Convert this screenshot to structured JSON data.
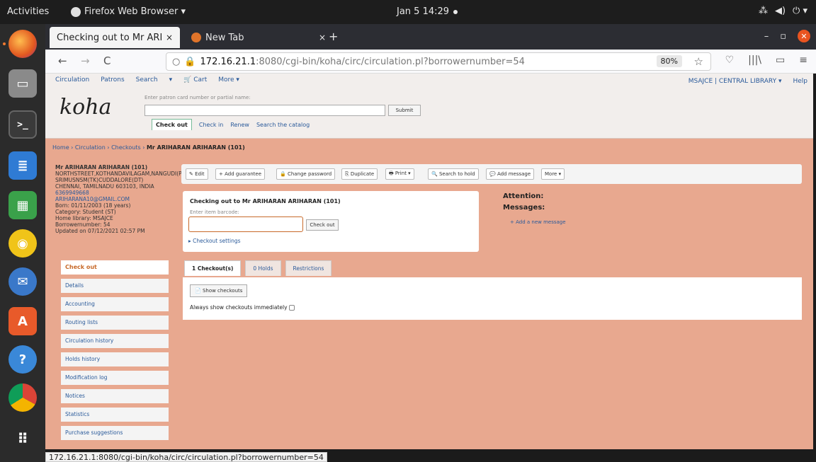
{
  "os_bar": {
    "activities": "Activities",
    "app_name": "Firefox Web Browser ▾",
    "clock": "Jan 5 14:29",
    "tray": [
      "⁂",
      "◀)",
      "⏻ ▾"
    ]
  },
  "browser": {
    "tabs": [
      {
        "title": "Checking out to Mr ARIHAR/",
        "close": "×"
      },
      {
        "title": "New Tab",
        "close": "×"
      }
    ],
    "new_tab": "+",
    "window_controls": [
      "–",
      "▫",
      "✕"
    ],
    "nav": {
      "back": "←",
      "forward": "→",
      "reload": "C"
    },
    "url_host": "172.16.21.1",
    "url_path": ":8080/cgi-bin/koha/circ/circulation.pl?borrowernumber=54",
    "zoom": "80%",
    "nav_right_icons": [
      "♡",
      "|||\\",
      "▭",
      "≡"
    ],
    "status_url": "172.16.21.1:8080/cgi-bin/koha/circ/circulation.pl?borrowernumber=54"
  },
  "koha": {
    "menu": [
      "Circulation",
      "Patrons",
      "Search",
      "▾",
      "🛒 Cart",
      "More ▾"
    ],
    "right_menu": [
      "MSAJCE | CENTRAL LIBRARY ▾",
      "Help"
    ],
    "logo": "koha",
    "search_prompt": "Enter patron card number or partial name:",
    "submit": "Submit",
    "search_tabs": [
      "Check out",
      "Check in",
      "Renew",
      "Search the catalog"
    ],
    "breadcrumb": {
      "home": "Home",
      "circulation": "Circulation",
      "checkouts": "Checkouts",
      "current": "Mr ARIHARAN ARIHARAN (101)"
    },
    "patron": {
      "name": "Mr ARIHARAN ARIHARAN (101)",
      "address1": "NORTHSTREET,KOTHANDAVILAGAM,NANGUDI(PO),",
      "address2": "SRIMUSNSM(TK)CUDDALORE(DT)",
      "address3": "CHENNAI, TAMILNADU 603103, INDIA",
      "phone": "6369949668",
      "email": "ARIHARANA10@GMAIL.COM",
      "born": "Born: 01/11/2003 (18 years)",
      "category": "Category: Student (ST)",
      "library": "Home library: MSAJCE",
      "borrowernumber": "Borrowernumber: 54",
      "updated": "Updated on 07/12/2021 02:57 PM"
    },
    "toolbar": [
      "✎ Edit",
      "+ Add guarantee",
      "🔒 Change password",
      "⎘ Duplicate",
      "🖶 Print ▾",
      "🔍 Search to hold",
      "💬 Add message",
      "More ▾"
    ],
    "checkout": {
      "title": "Checking out to Mr ARIHARAN ARIHARAN (101)",
      "barcode_label": "Enter item barcode:",
      "button": "Check out",
      "settings": "▸ Checkout settings"
    },
    "attention": "Attention:",
    "messages": "Messages:",
    "add_message": "+ Add a new message",
    "left_nav": [
      "Check out",
      "Details",
      "Accounting",
      "Routing lists",
      "Circulation history",
      "Holds history",
      "Modification log",
      "Notices",
      "Statistics",
      "Purchase suggestions"
    ],
    "content_tabs": [
      "1 Checkout(s)",
      "0 Holds",
      "Restrictions"
    ],
    "show_checkouts": "📄 Show checkouts",
    "always_show": "Always show checkouts immediately"
  }
}
